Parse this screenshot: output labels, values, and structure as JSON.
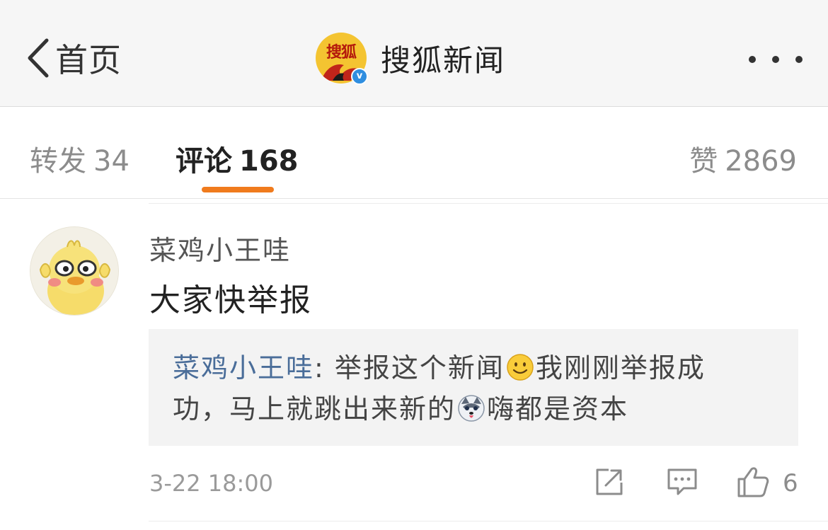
{
  "nav": {
    "back_label": "首页",
    "account_name": "搜狐新闻",
    "logo_text": "搜狐",
    "verify_mark": "v",
    "icons": {
      "back": "chevron-left-icon",
      "more": "more-dots-icon",
      "verified": "verified-badge-icon"
    }
  },
  "tabs": {
    "repost": {
      "label": "转发",
      "count": "34"
    },
    "comment": {
      "label": "评论",
      "count": "168"
    },
    "like": {
      "label": "赞",
      "count": "2869"
    },
    "active": "comment",
    "accent_color": "#f07b1d"
  },
  "comment": {
    "username": "菜鸡小王哇",
    "text": "大家快举报",
    "reply": {
      "user": "菜鸡小王哇",
      "part1": ": 举报这个新闻",
      "part2": "我刚刚举报成",
      "part3": "功，马上就跳出来新的",
      "part4": "嗨都是资本",
      "emojis": [
        "smile-emoji",
        "husky-emoji"
      ]
    },
    "timestamp": "3-22 18:00",
    "like_count": "6",
    "icons": {
      "share": "share-icon",
      "reply": "comment-icon",
      "like": "thumbs-up-icon"
    }
  },
  "colors": {
    "link": "#4a6d99",
    "verified": "#2f8ee0",
    "logo_bg": "#f4c431"
  }
}
